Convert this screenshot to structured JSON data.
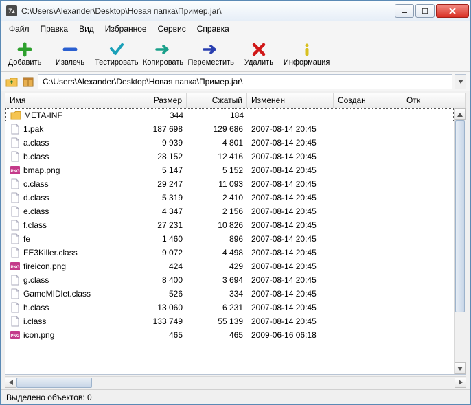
{
  "title": "C:\\Users\\Alexander\\Desktop\\Новая папка\\Пример.jar\\",
  "app_icon": "7z",
  "menu": [
    "Файл",
    "Правка",
    "Вид",
    "Избранное",
    "Сервис",
    "Справка"
  ],
  "toolbar": {
    "add": "Добавить",
    "extract": "Извлечь",
    "test": "Тестировать",
    "copy": "Копировать",
    "move": "Переместить",
    "delete": "Удалить",
    "info": "Информация"
  },
  "address": "C:\\Users\\Alexander\\Desktop\\Новая папка\\Пример.jar\\",
  "columns": {
    "name": "Имя",
    "size": "Размер",
    "packed": "Сжатый",
    "modified": "Изменен",
    "created": "Создан",
    "extra": "Отк"
  },
  "files": [
    {
      "icon": "folder",
      "name": "META-INF",
      "size": "344",
      "packed": "184",
      "modified": "",
      "selected": true
    },
    {
      "icon": "file",
      "name": "1.pak",
      "size": "187 698",
      "packed": "129 686",
      "modified": "2007-08-14 20:45"
    },
    {
      "icon": "file",
      "name": "a.class",
      "size": "9 939",
      "packed": "4 801",
      "modified": "2007-08-14 20:45"
    },
    {
      "icon": "file",
      "name": "b.class",
      "size": "28 152",
      "packed": "12 416",
      "modified": "2007-08-14 20:45"
    },
    {
      "icon": "png",
      "name": "bmap.png",
      "size": "5 147",
      "packed": "5 152",
      "modified": "2007-08-14 20:45"
    },
    {
      "icon": "file",
      "name": "c.class",
      "size": "29 247",
      "packed": "11 093",
      "modified": "2007-08-14 20:45"
    },
    {
      "icon": "file",
      "name": "d.class",
      "size": "5 319",
      "packed": "2 410",
      "modified": "2007-08-14 20:45"
    },
    {
      "icon": "file",
      "name": "e.class",
      "size": "4 347",
      "packed": "2 156",
      "modified": "2007-08-14 20:45"
    },
    {
      "icon": "file",
      "name": "f.class",
      "size": "27 231",
      "packed": "10 826",
      "modified": "2007-08-14 20:45"
    },
    {
      "icon": "file",
      "name": "fe",
      "size": "1 460",
      "packed": "896",
      "modified": "2007-08-14 20:45"
    },
    {
      "icon": "file",
      "name": "FE3Killer.class",
      "size": "9 072",
      "packed": "4 498",
      "modified": "2007-08-14 20:45"
    },
    {
      "icon": "png",
      "name": "fireicon.png",
      "size": "424",
      "packed": "429",
      "modified": "2007-08-14 20:45"
    },
    {
      "icon": "file",
      "name": "g.class",
      "size": "8 400",
      "packed": "3 694",
      "modified": "2007-08-14 20:45"
    },
    {
      "icon": "file",
      "name": "GameMIDlet.class",
      "size": "526",
      "packed": "334",
      "modified": "2007-08-14 20:45"
    },
    {
      "icon": "file",
      "name": "h.class",
      "size": "13 060",
      "packed": "6 231",
      "modified": "2007-08-14 20:45"
    },
    {
      "icon": "file",
      "name": "i.class",
      "size": "133 749",
      "packed": "55 139",
      "modified": "2007-08-14 20:45"
    },
    {
      "icon": "png",
      "name": "icon.png",
      "size": "465",
      "packed": "465",
      "modified": "2009-06-16 06:18"
    }
  ],
  "status": "Выделено объектов: 0"
}
